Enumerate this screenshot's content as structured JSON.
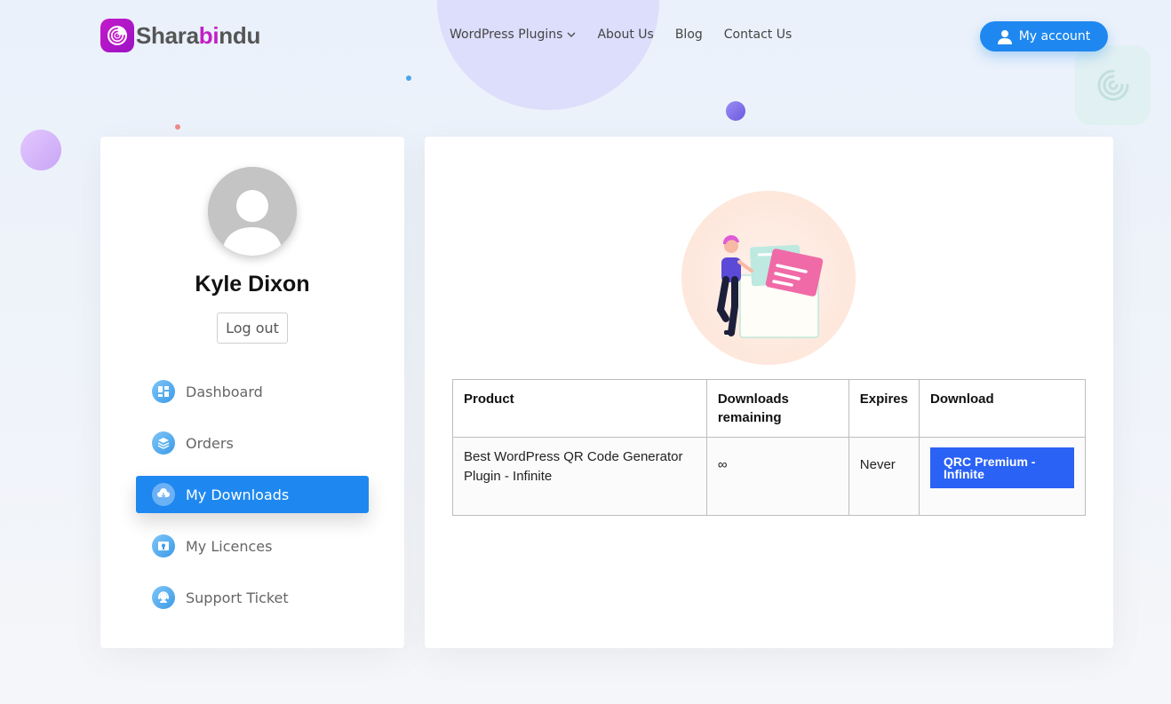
{
  "header": {
    "logo": {
      "part1": "Shara",
      "part2": "bi",
      "part3": "ndu"
    },
    "nav": [
      {
        "label": "WordPress Plugins",
        "has_dropdown": true
      },
      {
        "label": "About Us"
      },
      {
        "label": "Blog"
      },
      {
        "label": "Contact Us"
      }
    ],
    "account_label": "My account"
  },
  "sidebar": {
    "user_name": "Kyle Dixon",
    "logout_label": "Log out",
    "menu": [
      {
        "label": "Dashboard",
        "icon": "dashboard-icon"
      },
      {
        "label": "Orders",
        "icon": "orders-icon"
      },
      {
        "label": "My Downloads",
        "icon": "download-icon",
        "active": true
      },
      {
        "label": "My Licences",
        "icon": "licence-icon"
      },
      {
        "label": "Support Ticket",
        "icon": "support-icon"
      }
    ]
  },
  "downloads_table": {
    "headers": [
      "Product",
      "Downloads remaining",
      "Expires",
      "Download"
    ],
    "rows": [
      {
        "product": "Best WordPress QR Code Generator Plugin - Infinite",
        "remaining": "∞",
        "expires": "Never",
        "download_label": "QRC Premium - Infinite"
      }
    ]
  },
  "colors": {
    "accent": "#1e88f0",
    "download_button": "#2a62f5",
    "brand": "#c11fc6"
  }
}
